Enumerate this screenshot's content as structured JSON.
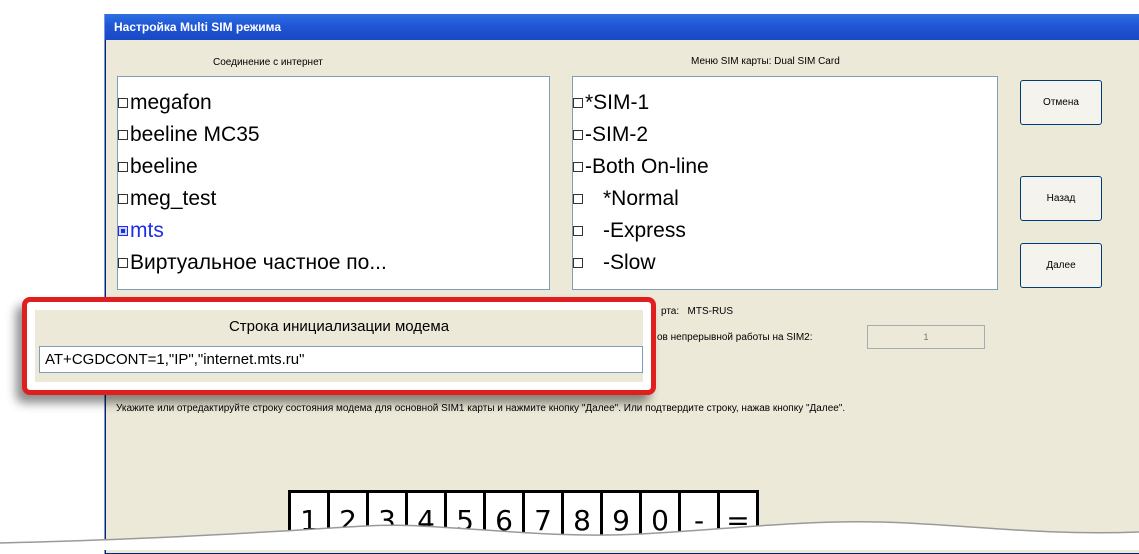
{
  "window": {
    "title": "Настройка Multi SIM режима"
  },
  "internet": {
    "caption": "Соединение с интернет",
    "items": [
      {
        "label": "megafon",
        "checked": false
      },
      {
        "label": "beeline MC35",
        "checked": false
      },
      {
        "label": "beeline",
        "checked": false
      },
      {
        "label": "meg_test",
        "checked": false
      },
      {
        "label": "mts",
        "checked": true
      },
      {
        "label": "Виртуальное частное по...",
        "checked": false
      }
    ]
  },
  "simmenu": {
    "caption": "Меню SIM карты: Dual SIM Card",
    "items": [
      {
        "label": "*SIM-1"
      },
      {
        "label": "-SIM-2"
      },
      {
        "label": "-Both On-line"
      },
      {
        "label": "*Normal"
      },
      {
        "label": "-Express"
      },
      {
        "label": "-Slow"
      }
    ]
  },
  "buttons": {
    "cancel": "Отмена",
    "back": "Назад",
    "next": "Далее"
  },
  "operator": {
    "label": "рта:",
    "value": "MTS-RUS"
  },
  "sim2_time": {
    "label": "ов непрерывной работы на SIM2:",
    "value": "1"
  },
  "instruction": "Укажите или отредактируйте строку состояния модема для основной SIM1 карты и нажмите кнопку \"Далее\". Или подтвердите строку, нажав кнопку \"Далее\".",
  "callout": {
    "title": "Строка инициализации модема",
    "init_string": "AT+CGDCONT=1,\"IP\",\"internet.mts.ru\""
  },
  "keypad": {
    "keys": [
      "1",
      "2",
      "3",
      "4",
      "5",
      "6",
      "7",
      "8",
      "9",
      "0",
      "-",
      "="
    ]
  },
  "colors": {
    "title_bar": "#1f56d6",
    "selected_text": "#1c2ee8",
    "callout_border": "#e11e1e",
    "dialog_bg": "#ece9d8"
  }
}
